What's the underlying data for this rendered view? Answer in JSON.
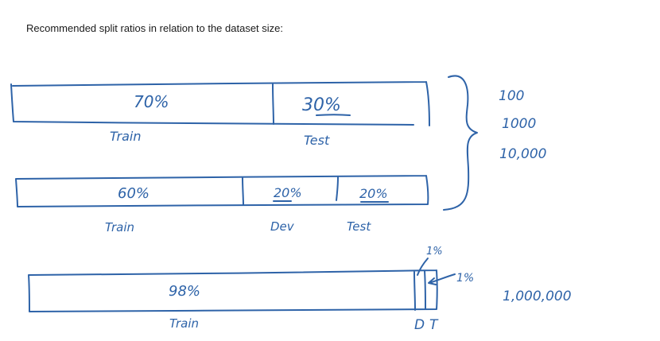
{
  "heading": "Recommended split ratios in relation to the dataset size:",
  "ink_color": "#2e63a8",
  "bars": [
    {
      "segments": [
        {
          "percent": "70%",
          "name": "Train"
        },
        {
          "percent": "30%",
          "name": "Test"
        }
      ]
    },
    {
      "segments": [
        {
          "percent": "60%",
          "name": "Train"
        },
        {
          "percent": "20%",
          "name": "Dev"
        },
        {
          "percent": "20%",
          "name": "Test"
        }
      ]
    },
    {
      "segments": [
        {
          "percent": "98%",
          "name": "Train"
        },
        {
          "percent": "1%",
          "name": "D"
        },
        {
          "percent": "1%",
          "name": "T"
        }
      ]
    }
  ],
  "small_sizes": [
    "100",
    "1000",
    "10,000"
  ],
  "large_size": "1,000,000"
}
